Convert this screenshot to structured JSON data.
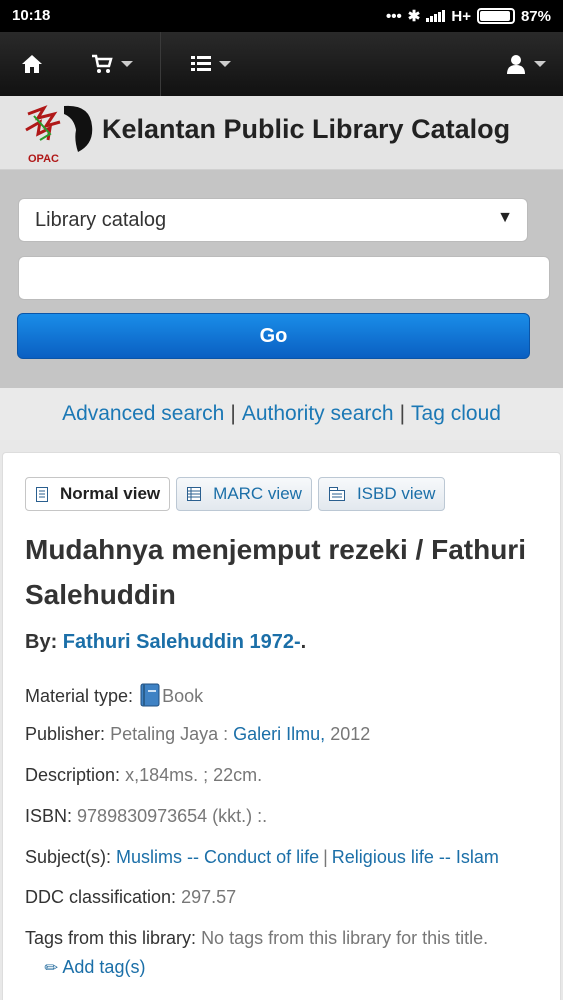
{
  "status_bar": {
    "time": "10:18",
    "network": "H+",
    "battery": "87%"
  },
  "navbar": {
    "home_icon": "home-icon",
    "cart_icon": "cart-icon",
    "lists_icon": "list-icon",
    "user_icon": "user-icon"
  },
  "header": {
    "logo_text": "OPAC",
    "title": "Kelantan Public Library Catalog"
  },
  "search": {
    "scope_selected": "Library catalog",
    "query_value": "",
    "go_label": "Go"
  },
  "links": {
    "advanced": "Advanced search",
    "authority": "Authority search",
    "tags": "Tag cloud",
    "separator": "|"
  },
  "view_tabs": [
    {
      "label": "Normal view",
      "active": true
    },
    {
      "label": "MARC view",
      "active": false
    },
    {
      "label": "ISBD view",
      "active": false
    }
  ],
  "record": {
    "title": "Mudahnya menjemput rezeki / Fathuri Salehuddin",
    "by_label": "By:",
    "author": "Fathuri Salehuddin 1972-",
    "author_suffix": ".",
    "material_type_label": "Material type:",
    "material_type": "Book",
    "publisher_label": "Publisher:",
    "publisher_place": "Petaling Jaya :",
    "publisher_name": "Galeri Ilmu,",
    "publisher_year": "2012",
    "description_label": "Description:",
    "description": "x,184ms. ; 22cm.",
    "isbn_label": "ISBN:",
    "isbn": "9789830973654 (kkt.) :.",
    "subjects_label": "Subject(s):",
    "subjects": [
      "Muslims -- Conduct of life",
      "Religious life -- Islam"
    ],
    "subjects_separator": "|",
    "ddc_label": "DDC classification:",
    "ddc": "297.57",
    "tags_label": "Tags from this library:",
    "tags_value": "No tags from this library for this title.",
    "add_tag": "Add tag(s)"
  },
  "colors": {
    "link": "#1b6fa8",
    "go_button": "#0a5fc2",
    "navbar": "#111111"
  }
}
